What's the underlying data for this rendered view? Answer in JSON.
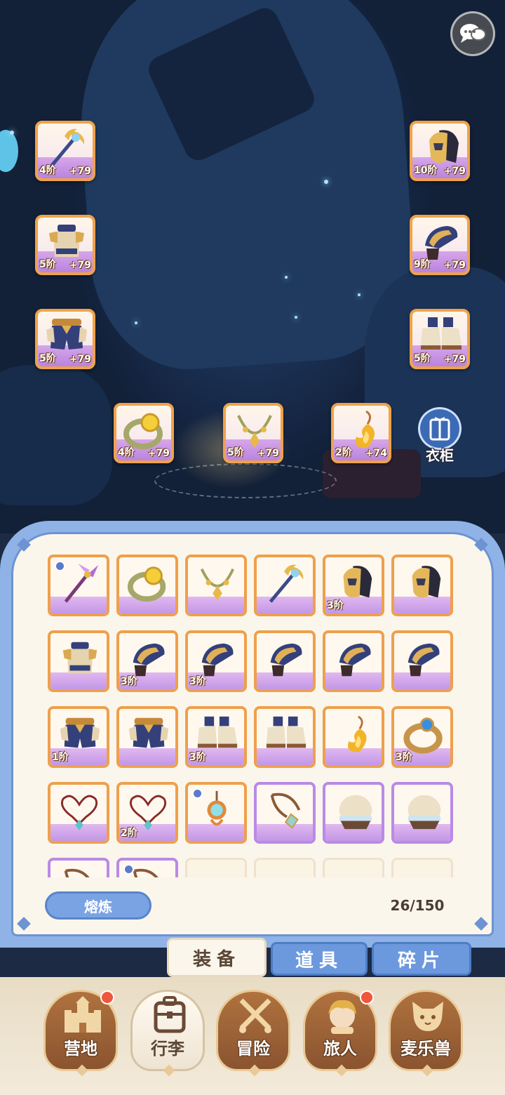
{
  "equipped": {
    "weapon": {
      "tier": "4阶",
      "plus": "+79",
      "icon": "golden-staff-icon"
    },
    "helmet": {
      "tier": "10阶",
      "plus": "+79",
      "icon": "golden-helmet-icon"
    },
    "chest": {
      "tier": "5阶",
      "plus": "+79",
      "icon": "armor-chest-icon"
    },
    "gloves": {
      "tier": "9阶",
      "plus": "+79",
      "icon": "gauntlet-icon"
    },
    "legs": {
      "tier": "5阶",
      "plus": "+79",
      "icon": "leg-armor-icon"
    },
    "boots": {
      "tier": "5阶",
      "plus": "+79",
      "icon": "boots-icon"
    },
    "ring": {
      "tier": "4阶",
      "plus": "+79",
      "icon": "ring-icon"
    },
    "necklace": {
      "tier": "5阶",
      "plus": "+79",
      "icon": "necklace-icon"
    },
    "charm": {
      "tier": "2阶",
      "plus": "+74",
      "icon": "flame-charm-icon"
    }
  },
  "wardrobe": {
    "label": "衣柜",
    "icon": "wardrobe-icon"
  },
  "inventory": {
    "items": [
      {
        "icon": "purple-staff-icon",
        "tier": "",
        "locked": true,
        "rarity": "orange"
      },
      {
        "icon": "ring-icon",
        "tier": "",
        "locked": false,
        "rarity": "orange"
      },
      {
        "icon": "necklace-icon",
        "tier": "",
        "locked": false,
        "rarity": "orange"
      },
      {
        "icon": "golden-staff-icon",
        "tier": "",
        "locked": false,
        "rarity": "orange"
      },
      {
        "icon": "golden-helmet-icon",
        "tier": "3阶",
        "locked": false,
        "rarity": "orange"
      },
      {
        "icon": "golden-helmet-icon",
        "tier": "",
        "locked": false,
        "rarity": "orange"
      },
      {
        "icon": "armor-chest-icon",
        "tier": "",
        "locked": false,
        "rarity": "orange"
      },
      {
        "icon": "gauntlet-icon",
        "tier": "3阶",
        "locked": false,
        "rarity": "orange"
      },
      {
        "icon": "gauntlet-icon",
        "tier": "3阶",
        "locked": false,
        "rarity": "orange"
      },
      {
        "icon": "gauntlet-icon",
        "tier": "",
        "locked": false,
        "rarity": "orange"
      },
      {
        "icon": "gauntlet-icon",
        "tier": "",
        "locked": false,
        "rarity": "orange"
      },
      {
        "icon": "gauntlet-icon",
        "tier": "",
        "locked": false,
        "rarity": "orange"
      },
      {
        "icon": "leg-armor-icon",
        "tier": "1阶",
        "locked": false,
        "rarity": "orange"
      },
      {
        "icon": "leg-armor-icon",
        "tier": "",
        "locked": false,
        "rarity": "orange"
      },
      {
        "icon": "boots-icon",
        "tier": "3阶",
        "locked": false,
        "rarity": "orange"
      },
      {
        "icon": "boots-icon",
        "tier": "",
        "locked": false,
        "rarity": "orange"
      },
      {
        "icon": "flame-charm-icon",
        "tier": "",
        "locked": false,
        "rarity": "orange"
      },
      {
        "icon": "sapphire-ring-icon",
        "tier": "3阶",
        "locked": false,
        "rarity": "orange"
      },
      {
        "icon": "heart-necklace-icon",
        "tier": "",
        "locked": false,
        "rarity": "orange"
      },
      {
        "icon": "heart-necklace-icon",
        "tier": "2阶",
        "locked": false,
        "rarity": "orange"
      },
      {
        "icon": "compass-amulet-icon",
        "tier": "",
        "locked": true,
        "rarity": "orange"
      },
      {
        "icon": "cord-pendant-icon",
        "tier": "",
        "locked": false,
        "rarity": "purple"
      },
      {
        "icon": "cloth-cap-icon",
        "tier": "",
        "locked": false,
        "rarity": "purple"
      },
      {
        "icon": "cloth-cap-icon",
        "tier": "",
        "locked": false,
        "rarity": "purple"
      },
      {
        "icon": "cord-pendant-icon",
        "tier": "",
        "locked": false,
        "rarity": "purple"
      },
      {
        "icon": "cord-pendant-icon",
        "tier": "",
        "locked": true,
        "rarity": "purple"
      },
      {
        "icon": "",
        "tier": "",
        "locked": false,
        "rarity": "empty"
      },
      {
        "icon": "",
        "tier": "",
        "locked": false,
        "rarity": "empty"
      },
      {
        "icon": "",
        "tier": "",
        "locked": false,
        "rarity": "empty"
      },
      {
        "icon": "",
        "tier": "",
        "locked": false,
        "rarity": "empty"
      }
    ],
    "smelt_label": "熔炼",
    "capacity": "26/150"
  },
  "tabs": [
    {
      "label": "装备",
      "active": true
    },
    {
      "label": "道具",
      "active": false
    },
    {
      "label": "碎片",
      "active": false
    }
  ],
  "nav": [
    {
      "label": "营地",
      "icon": "castle-icon",
      "badge": true,
      "active": false
    },
    {
      "label": "行李",
      "icon": "backpack-icon",
      "badge": false,
      "active": true
    },
    {
      "label": "冒险",
      "icon": "crossed-swords-icon",
      "badge": false,
      "active": false
    },
    {
      "label": "旅人",
      "icon": "traveler-portrait-icon",
      "badge": true,
      "active": false
    },
    {
      "label": "麦乐兽",
      "icon": "pet-cat-icon",
      "badge": false,
      "active": false
    }
  ],
  "colors": {
    "orange_rarity": "#eea04c",
    "purple_rarity": "#b98ae6",
    "panel_frame": "#8fb3e6",
    "tab_inactive": "#6c98de",
    "badge": "#f0563c"
  }
}
